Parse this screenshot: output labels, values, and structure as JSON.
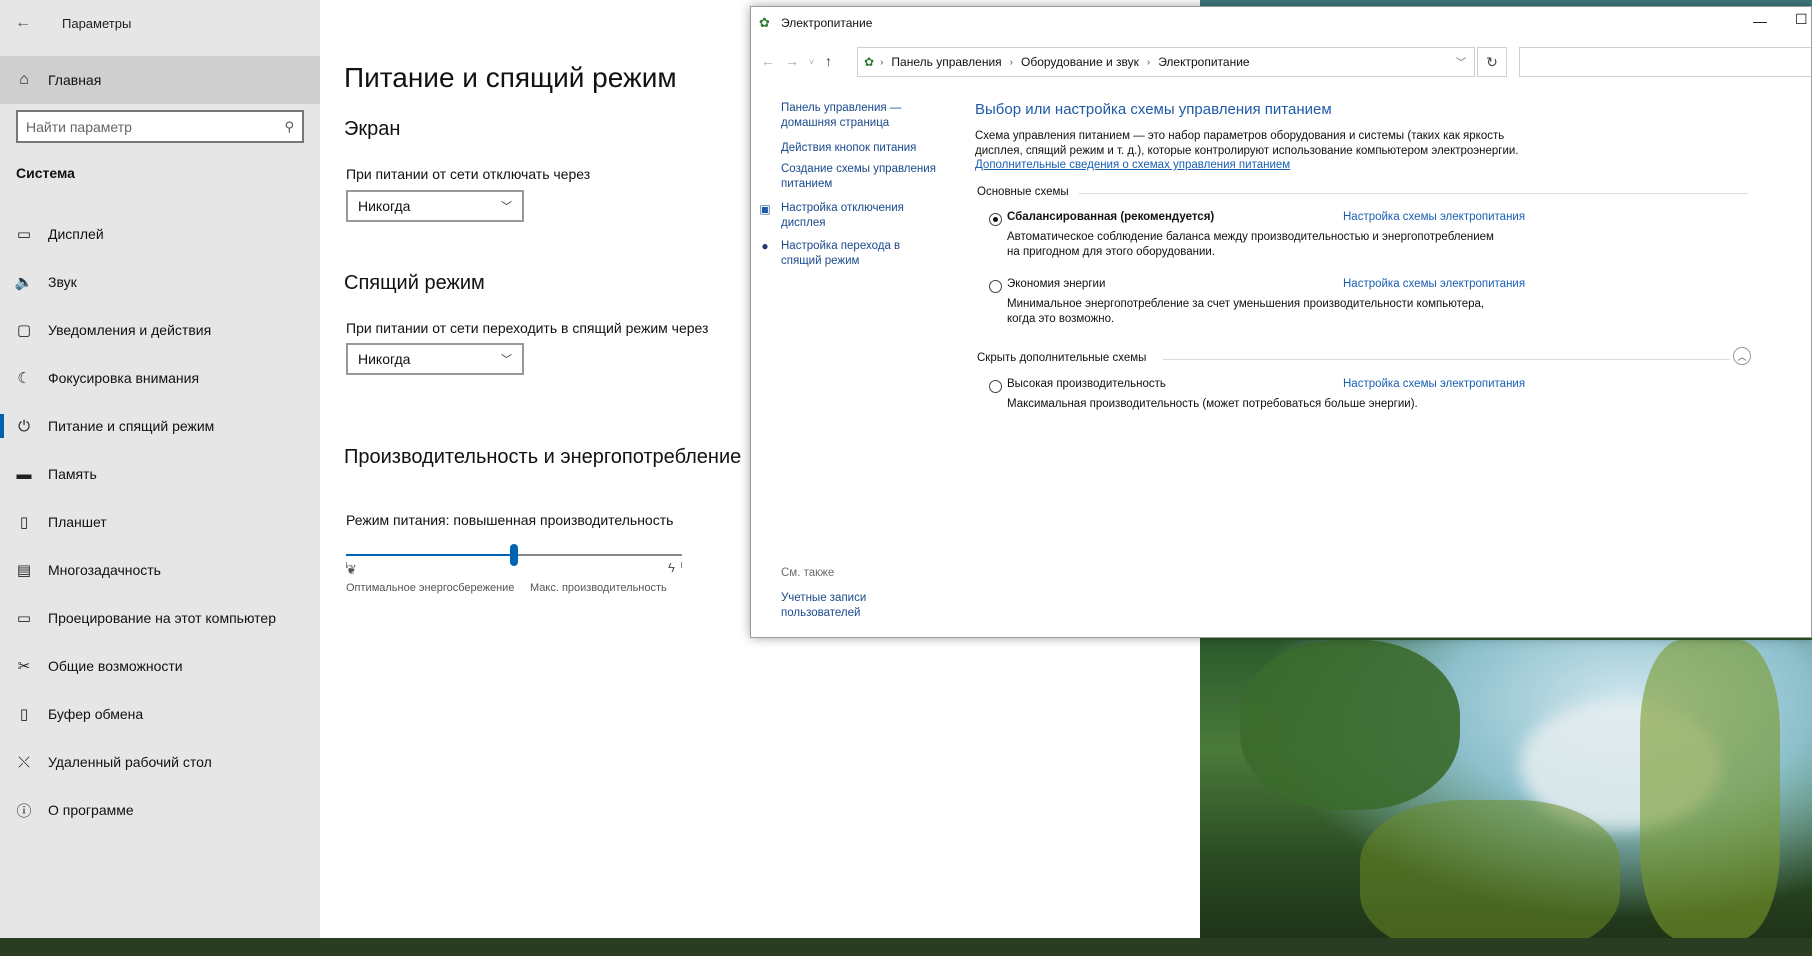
{
  "settings": {
    "app_title": "Параметры",
    "home_label": "Главная",
    "search_placeholder": "Найти параметр",
    "section_label": "Система",
    "nav": [
      {
        "label": "Дисплей",
        "icon": "display-icon"
      },
      {
        "label": "Звук",
        "icon": "sound-icon"
      },
      {
        "label": "Уведомления и действия",
        "icon": "notifications-icon"
      },
      {
        "label": "Фокусировка внимания",
        "icon": "focus-assist-icon"
      },
      {
        "label": "Питание и спящий режим",
        "icon": "power-icon"
      },
      {
        "label": "Память",
        "icon": "storage-icon"
      },
      {
        "label": "Планшет",
        "icon": "tablet-icon"
      },
      {
        "label": "Многозадачность",
        "icon": "multitasking-icon"
      },
      {
        "label": "Проецирование на этот компьютер",
        "icon": "projecting-icon"
      },
      {
        "label": "Общие возможности",
        "icon": "shared-experiences-icon"
      },
      {
        "label": "Буфер обмена",
        "icon": "clipboard-icon"
      },
      {
        "label": "Удаленный рабочий стол",
        "icon": "remote-desktop-icon"
      },
      {
        "label": "О программе",
        "icon": "about-icon"
      }
    ],
    "active_nav": "Питание и спящий режим",
    "page_title": "Питание и спящий режим",
    "screen": {
      "heading": "Экран",
      "label": "При питании от сети отключать через",
      "value": "Никогда"
    },
    "sleep": {
      "heading": "Спящий режим",
      "label": "При питании от сети переходить в спящий режим через",
      "value": "Никогда"
    },
    "performance": {
      "heading": "Производительность и энергопотребление",
      "mode_label": "Режим питания: повышенная производительность",
      "slider_level": 0.5,
      "left_caption": "Оптимальное энергосбережение",
      "right_caption": "Макс. производительность"
    }
  },
  "control_panel": {
    "title": "Электропитание",
    "breadcrumb": [
      "Панель управления",
      "Оборудование и звук",
      "Электропитание"
    ],
    "left_links": {
      "home": "Панель управления — домашняя страница",
      "buttons": "Действия кнопок питания",
      "create_plan": "Создание схемы управления питанием",
      "display_off": "Настройка отключения дисплея",
      "sleep": "Настройка перехода в спящий режим"
    },
    "see_also": "См. также",
    "user_accounts": "Учетные записи пользователей",
    "heading": "Выбор или настройка схемы управления питанием",
    "desc_line1": "Схема управления питанием — это набор параметров оборудования и системы (таких как яркость",
    "desc_line2": "дисплея, спящий режим и т. д.), которые контролируют использование компьютером электроэнергии.",
    "more_info": "Дополнительные сведения о схемах управления питанием",
    "group_main": "Основные схемы",
    "group_hidden": "Скрыть дополнительные схемы",
    "plan_link": "Настройка схемы электропитания",
    "plans": [
      {
        "name": "Сбалансированная (рекомендуется)",
        "selected": true,
        "desc1": "Автоматическое соблюдение баланса между производительностью и энергопотреблением",
        "desc2": "на пригодном для этого оборудовании."
      },
      {
        "name": "Экономия энергии",
        "selected": false,
        "desc1": "Минимальное энергопотребление за счет уменьшения производительности компьютера,",
        "desc2": "когда это возможно."
      },
      {
        "name": "Высокая производительность",
        "selected": false,
        "desc1": "Максимальная производительность (может потребоваться больше энергии).",
        "desc2": ""
      }
    ]
  }
}
